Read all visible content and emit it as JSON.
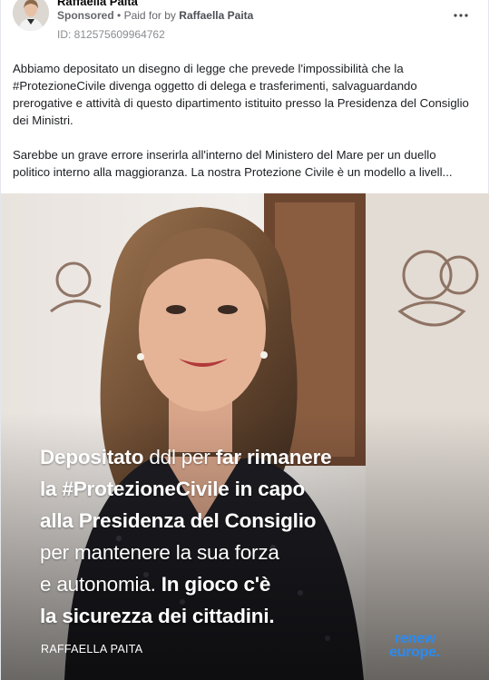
{
  "ad": {
    "page_name": "Raffaella Paita",
    "sponsored_label": "Sponsored",
    "paid_for_prefix": "Paid for by",
    "payer": "Raffaella Paita",
    "ad_id": "ID: 812575609964762",
    "more_icon": "more-horizontal-icon"
  },
  "post": {
    "paragraph_1": "Abbiamo depositato un disegno di legge che prevede l'impossibilità che la #ProtezioneCivile divenga oggetto di delega e trasferimenti, salvaguardando prerogative e attività di questo dipartimento istituito presso la Presidenza del Consiglio dei Ministri.",
    "paragraph_2": "Sarebbe un grave errore inserirla all'interno del Ministero del Mare per un duello politico interno alla maggioranza. La nostra Protezione Civile è un modello a livell..."
  },
  "creative": {
    "lines": [
      {
        "bold": "Depositato ",
        "light": "ddl per ",
        "bold2": "far rimanere"
      },
      {
        "bold": "la #ProtezioneCivile in capo",
        "light": "",
        "bold2": ""
      },
      {
        "bold": "alla Presidenza del Consiglio",
        "light": "",
        "bold2": ""
      },
      {
        "bold": "",
        "light": "per mantenere la sua forza",
        "bold2": ""
      },
      {
        "bold": "",
        "light": "e autonomia. ",
        "bold2": "In gioco c'è"
      },
      {
        "bold": "la sicurezza dei cittadini.",
        "light": "",
        "bold2": ""
      }
    ],
    "signature": "RAFFAELLA PAITA",
    "logo_line_1": "renew",
    "logo_line_2": "europe.",
    "logo_color": "#2b8bf0"
  }
}
